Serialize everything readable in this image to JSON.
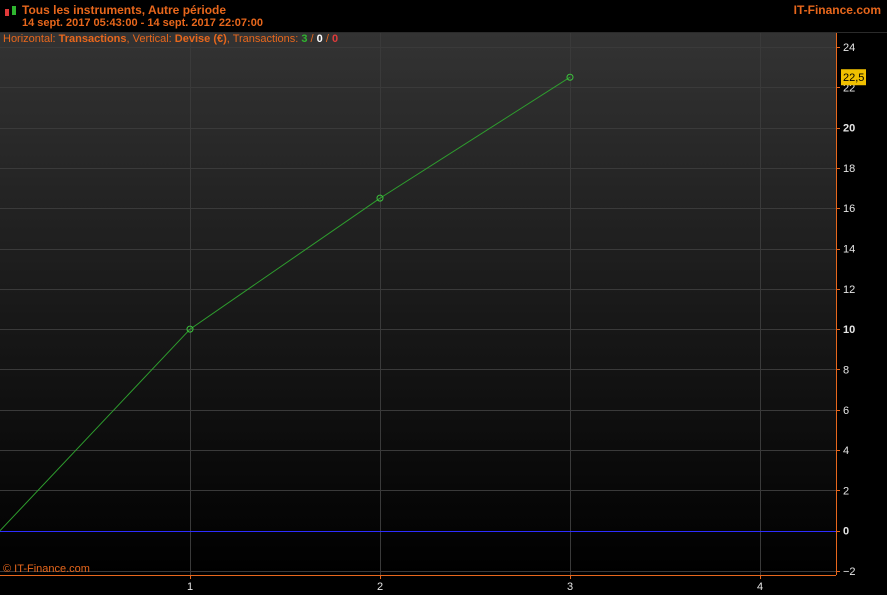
{
  "header": {
    "title": "Tous les instruments, Autre période",
    "period": "14 sept. 2017 05:43:00 - 14 sept. 2017 22:07:00",
    "brand": "IT-Finance.com"
  },
  "info": {
    "horizontal_label": "Horizontal: ",
    "horizontal_value": "Transactions",
    "vertical_label": ", Vertical: ",
    "vertical_value": "Devise (€)",
    "transactions_label": ", Transactions: ",
    "count_green": "3",
    "sep1": " / ",
    "count_white": "0",
    "sep2": " / ",
    "count_red": "0"
  },
  "footer": {
    "copyright": "© IT-Finance.com"
  },
  "colors": {
    "accent": "#e8671c",
    "series": "#2e9e2e",
    "zero_line": "#2d2dff",
    "last_value_bg": "#f0c000"
  },
  "chart_data": {
    "type": "line",
    "x": [
      0,
      1,
      2,
      3
    ],
    "y": [
      0,
      10,
      16.5,
      22.5
    ],
    "xlim": [
      0,
      4.4
    ],
    "ylim": [
      -2,
      24.5
    ],
    "x_ticks": [
      1,
      2,
      3,
      4
    ],
    "y_ticks": [
      -2,
      0,
      2,
      4,
      6,
      8,
      10,
      12,
      14,
      16,
      18,
      20,
      22,
      24
    ],
    "y_bold_ticks": [
      0,
      10,
      20
    ],
    "last_value_label": "22,5",
    "baseline": 0,
    "grid": true
  }
}
